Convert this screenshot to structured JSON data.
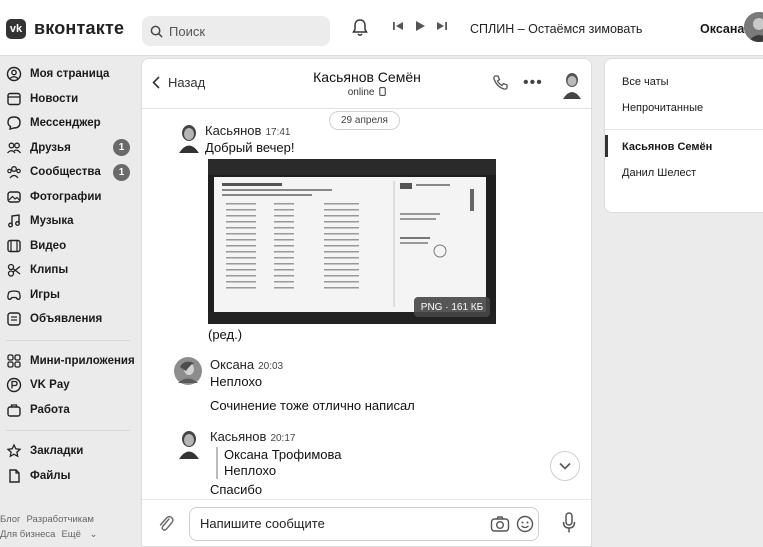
{
  "header": {
    "logo_badge": "vk",
    "logo_text": "вконтакте",
    "search_placeholder": "Поиск",
    "track": "СПЛИН – Остаёмся зимовать",
    "user_name": "Оксана"
  },
  "nav": {
    "items": [
      {
        "label": "Моя страница",
        "icon": "user-icon"
      },
      {
        "label": "Новости",
        "icon": "news-icon"
      },
      {
        "label": "Мессенджер",
        "icon": "message-icon"
      },
      {
        "label": "Друзья",
        "icon": "friends-icon",
        "count": "1"
      },
      {
        "label": "Сообщества",
        "icon": "communities-icon",
        "count": "1"
      },
      {
        "label": "Фотографии",
        "icon": "photo-icon"
      },
      {
        "label": "Музыка",
        "icon": "music-icon"
      },
      {
        "label": "Видео",
        "icon": "video-icon"
      },
      {
        "label": "Клипы",
        "icon": "clips-icon"
      },
      {
        "label": "Игры",
        "icon": "games-icon"
      },
      {
        "label": "Объявления",
        "icon": "ads-icon"
      }
    ],
    "items2": [
      {
        "label": "Мини-приложения",
        "icon": "apps-icon"
      },
      {
        "label": "VK Pay",
        "icon": "vkpay-icon"
      },
      {
        "label": "Работа",
        "icon": "work-icon"
      }
    ],
    "items3": [
      {
        "label": "Закладки",
        "icon": "bookmark-icon"
      },
      {
        "label": "Файлы",
        "icon": "files-icon"
      }
    ],
    "footer": {
      "blog": "Блог",
      "developers": "Разработчикам",
      "business": "Для бизнеса",
      "more": "Ещё"
    }
  },
  "chat": {
    "back_label": "Назад",
    "title": "Касьянов Семён",
    "status": "online",
    "date_pill": "29 апреля",
    "messages": [
      {
        "author": "Касьянов",
        "time": "17:41",
        "text": "Добрый вечер!",
        "edited": "(ред.)",
        "attachment": "PNG · 161 КБ"
      },
      {
        "author": "Оксана",
        "time": "20:03",
        "text": "Неплохо",
        "text2": "Сочинение тоже отлично написал"
      },
      {
        "author": "Касьянов",
        "time": "20:17",
        "quote_author": "Оксана Трофимова",
        "quote_text": "Неплохо",
        "text": "Спасибо"
      }
    ],
    "composer_placeholder": "Напишите сообщите"
  },
  "right": {
    "all_chats": "Все чаты",
    "unread": "Непрочитанные",
    "active_chat": "Касьянов Семён",
    "other_chat": "Данил Шелест"
  },
  "colors": {
    "accent": "#333333",
    "badge": "#6a6a6a"
  }
}
